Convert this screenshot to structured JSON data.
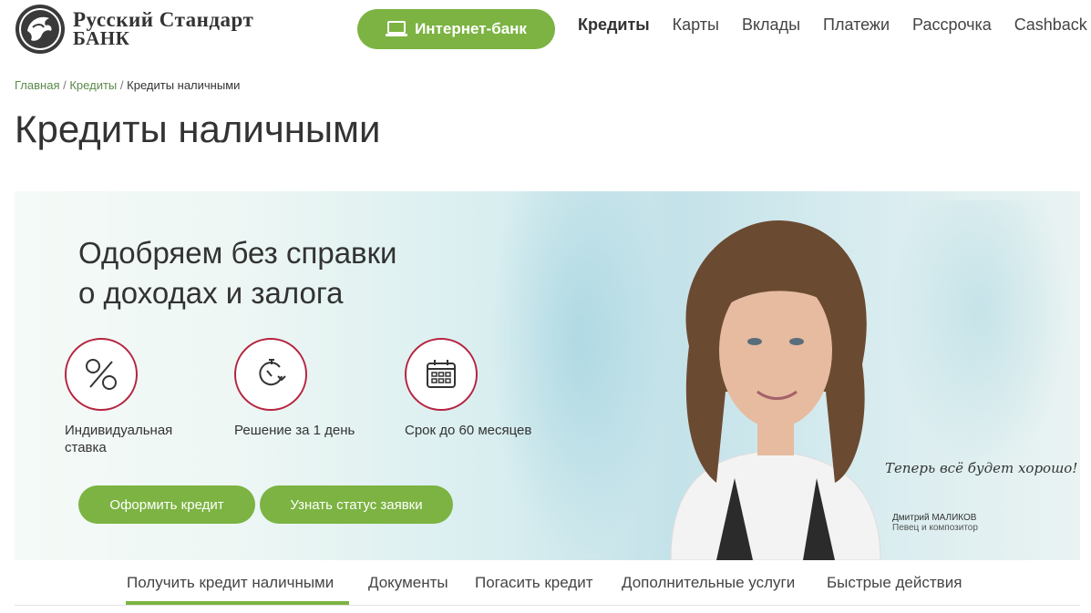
{
  "header": {
    "logo_line1": "Русский Стандарт",
    "logo_line2": "БАНК",
    "internet_bank": "Интернет-банк",
    "nav": [
      "Кредиты",
      "Карты",
      "Вклады",
      "Платежи",
      "Рассрочка",
      "Cashback"
    ]
  },
  "breadcrumb": {
    "home": "Главная",
    "credits": "Кредиты",
    "current": "Кредиты наличными",
    "separator": "/"
  },
  "page_title": "Кредиты наличными",
  "banner": {
    "title_line1": "Одобряем без справки",
    "title_line2": "о доходах и залога",
    "features": [
      {
        "icon": "percent-icon",
        "text_line1": "Индивидуальная",
        "text_line2": "ставка"
      },
      {
        "icon": "timer-icon",
        "text_line1": "Решение за 1 день",
        "text_line2": ""
      },
      {
        "icon": "calendar-icon",
        "text_line1": "Срок до 60 месяцев",
        "text_line2": ""
      }
    ],
    "apply_button": "Оформить кредит",
    "status_button": "Узнать статус заявки",
    "slogan": "Теперь всё будет хорошо!",
    "person_name": "Дмитрий МАЛИКОВ",
    "person_role": "Певец и композитор"
  },
  "tabs": [
    "Получить кредит наличными",
    "Документы",
    "Погасить кредит",
    "Дополнительные услуги",
    "Быстрые действия"
  ],
  "colors": {
    "accent_green": "#7cb342",
    "feature_red": "#b5243f",
    "text": "#333333"
  }
}
